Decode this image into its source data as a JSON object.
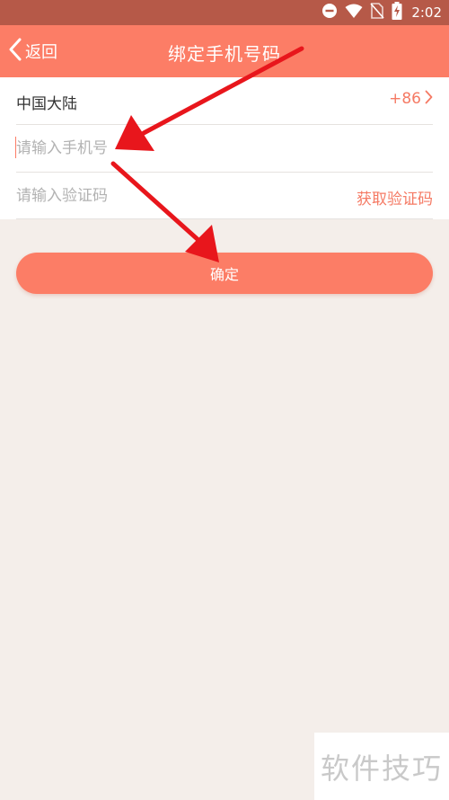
{
  "status_bar": {
    "time": "2:02",
    "icons": [
      "do-not-disturb-icon",
      "wifi-icon",
      "no-sim-icon",
      "battery-charging-icon"
    ]
  },
  "nav": {
    "back_label": "返回",
    "title": "绑定手机号码"
  },
  "form": {
    "region_label": "中国大陆",
    "region_code": "+86",
    "phone_placeholder": "请输入手机号",
    "code_placeholder": "请输入验证码",
    "get_code_label": "获取验证码"
  },
  "confirm_label": "确定",
  "watermark": "软件技巧",
  "colors": {
    "status_bar": "#b65948",
    "accent": "#fc7d66",
    "accent_text": "#f57a64",
    "background": "#f4eeea",
    "arrow": "#e8161c"
  }
}
